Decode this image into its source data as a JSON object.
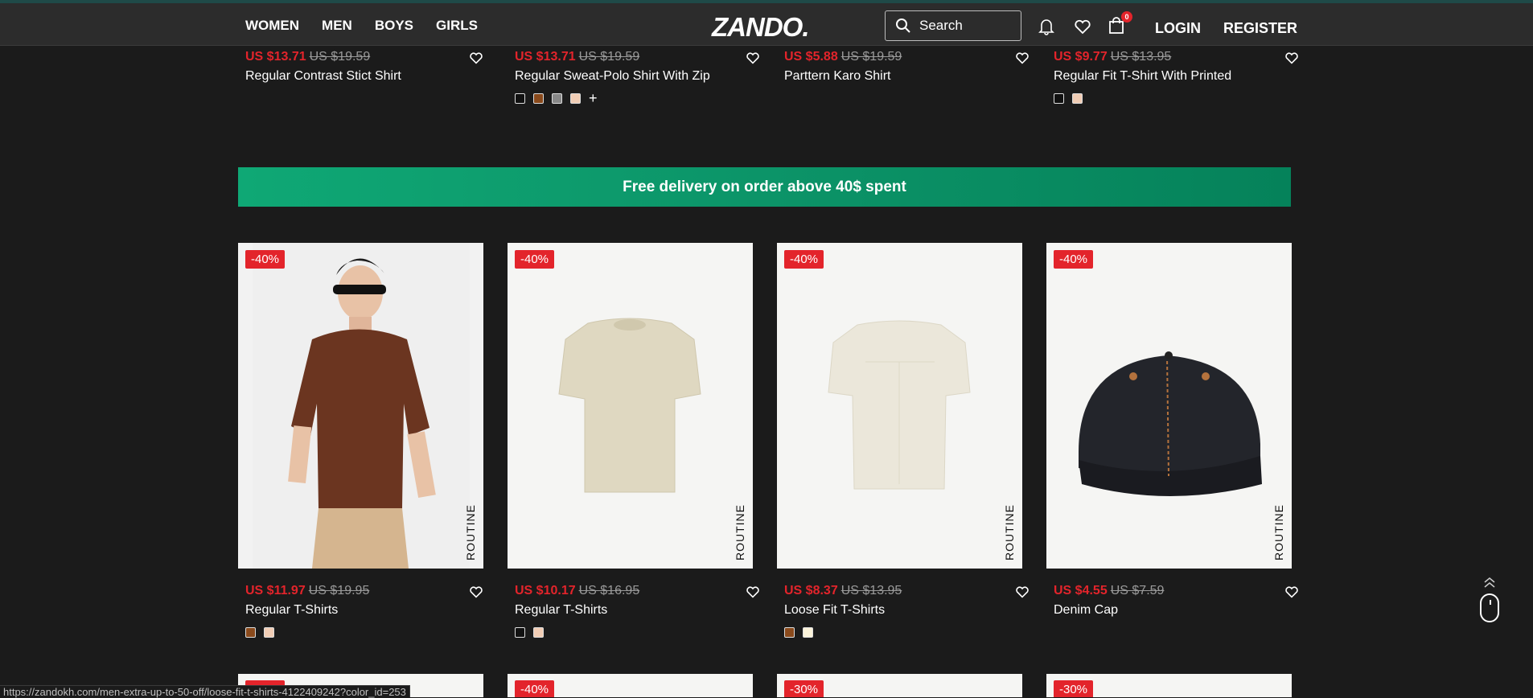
{
  "nav": {
    "women": "WOMEN",
    "men": "MEN",
    "boys": "BOYS",
    "girls": "GIRLS"
  },
  "brand": "ZANDO.",
  "search": {
    "placeholder": "Search"
  },
  "cart_count": "0",
  "auth": {
    "login": "LOGIN",
    "register": "REGISTER"
  },
  "top_products": [
    {
      "price": "US $13.71",
      "was": "US $19.59",
      "name": "Regular Contrast Stict Shirt",
      "swatches": []
    },
    {
      "price": "US $13.71",
      "was": "US $19.59",
      "name": "Regular Sweat-Polo Shirt With Zip",
      "swatches": [
        "#111111",
        "#8a4a1c",
        "#888888",
        "#f1cdb5"
      ],
      "more": "+"
    },
    {
      "price": "US $5.88",
      "was": "US $19.59",
      "name": "Parttern Karo Shirt",
      "swatches": []
    },
    {
      "price": "US $9.77",
      "was": "US $13.95",
      "name": "Regular Fit T-Shirt With Printed",
      "swatches": [
        "#111111",
        "#f1cdb5"
      ]
    }
  ],
  "banner": "Free delivery on order above 40$ spent",
  "products": [
    {
      "discount": "-40%",
      "brand": "ROUTINE",
      "price": "US $11.97",
      "was": "US $19.95",
      "name": "Regular T-Shirts",
      "swatches": [
        "#8a4a1c",
        "#f1cdb5"
      ]
    },
    {
      "discount": "-40%",
      "brand": "ROUTINE",
      "price": "US $10.17",
      "was": "US $16.95",
      "name": "Regular T-Shirts",
      "swatches": [
        "#111111",
        "#f1cdb5"
      ]
    },
    {
      "discount": "-40%",
      "brand": "ROUTINE",
      "price": "US $8.37",
      "was": "US $13.95",
      "name": "Loose Fit T-Shirts",
      "swatches": [
        "#8a4a1c",
        "#fbf3da"
      ]
    },
    {
      "discount": "-40%",
      "brand": "ROUTINE",
      "price": "US $4.55",
      "was": "US $7.59",
      "name": "Denim Cap",
      "swatches": []
    }
  ],
  "next_row_discounts": [
    "-40%",
    "-40%",
    "-30%",
    "-30%"
  ],
  "status_url": "https://zandokh.com/men-extra-up-to-50-off/loose-fit-t-shirts-4122409242?color_id=253",
  "colors": {
    "accent_red": "#e3242b",
    "banner_green": "#0c9468",
    "header_bg": "#2c2c2c",
    "page_bg": "#1b1b1b"
  }
}
